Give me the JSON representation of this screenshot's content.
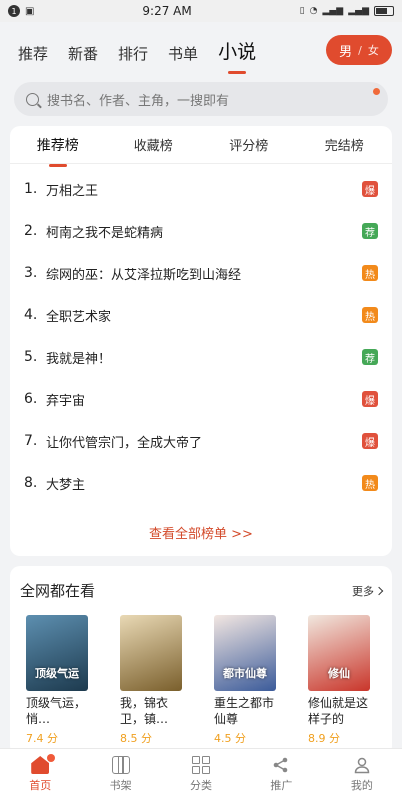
{
  "status": {
    "time": "9:27 AM",
    "notif_count": "1"
  },
  "topnav": {
    "tabs": [
      {
        "label": "推荐"
      },
      {
        "label": "新番"
      },
      {
        "label": "排行"
      },
      {
        "label": "书单"
      },
      {
        "label": "小说",
        "active": true
      }
    ],
    "gender": {
      "selected": "男",
      "separator": "/",
      "other": "女"
    }
  },
  "search": {
    "placeholder": "搜书名、作者、主角，一搜即有"
  },
  "ranking": {
    "tabs": [
      "推荐榜",
      "收藏榜",
      "评分榜",
      "完结榜"
    ],
    "items": [
      {
        "num": "1.",
        "title": "万相之王",
        "badge": "爆",
        "color": "#e0513c"
      },
      {
        "num": "2.",
        "title": "柯南之我不是蛇精病",
        "badge": "荐",
        "color": "#45a857"
      },
      {
        "num": "3.",
        "title": "综网的巫：从艾泽拉斯吃到山海经",
        "badge": "热",
        "color": "#f28a1b"
      },
      {
        "num": "4.",
        "title": "全职艺术家",
        "badge": "热",
        "color": "#f28a1b"
      },
      {
        "num": "5.",
        "title": "我就是神！",
        "badge": "荐",
        "color": "#45a857"
      },
      {
        "num": "6.",
        "title": "弃宇宙",
        "badge": "爆",
        "color": "#e0513c"
      },
      {
        "num": "7.",
        "title": "让你代管宗门，全成大帝了",
        "badge": "爆",
        "color": "#e0513c"
      },
      {
        "num": "8.",
        "title": "大梦主",
        "badge": "热",
        "color": "#f28a1b"
      }
    ],
    "more_label": "查看全部榜单 >>"
  },
  "hot": {
    "title": "全网都在看",
    "more_label": "更多",
    "books": [
      {
        "name": "顶级气运，悄…",
        "score": "7.4 分",
        "cover_text": "顶级气运",
        "c1": "#5d8fb0",
        "c2": "#1d3a4e"
      },
      {
        "name": "我，锦衣卫，镇…",
        "score": "8.5 分",
        "cover_text": "",
        "c1": "#e9d9b5",
        "c2": "#7a5f2c"
      },
      {
        "name": "重生之都市仙尊",
        "score": "4.5 分",
        "cover_text": "都市仙尊",
        "c1": "#f3e7e2",
        "c2": "#3b5b9a"
      },
      {
        "name": "修仙就是这样子的",
        "score": "8.9 分",
        "cover_text": "修仙",
        "c1": "#f1e8df",
        "c2": "#c9352a"
      }
    ]
  },
  "bottom": {
    "items": [
      {
        "label": "首页",
        "active": true
      },
      {
        "label": "书架"
      },
      {
        "label": "分类"
      },
      {
        "label": "推广"
      },
      {
        "label": "我的"
      }
    ]
  }
}
